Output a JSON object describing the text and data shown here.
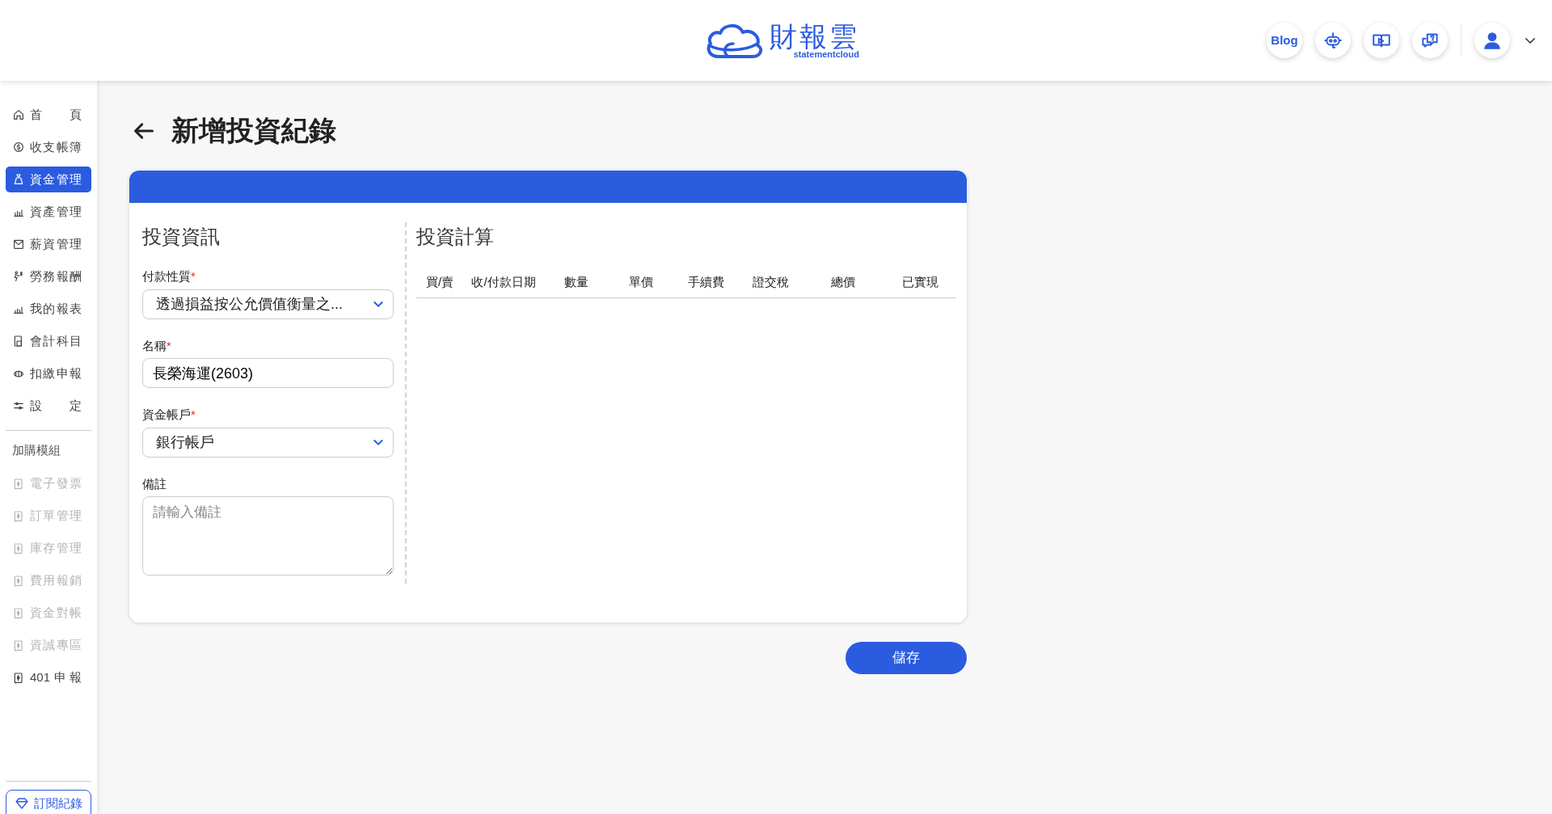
{
  "header": {
    "logo": {
      "name": "財報雲",
      "tagline": "statementcloud"
    },
    "blog_button": "Blog"
  },
  "sidebar": {
    "items": [
      {
        "label": "首頁",
        "selected": false
      },
      {
        "label": "收支帳簿",
        "selected": false
      },
      {
        "label": "資金管理",
        "selected": true
      },
      {
        "label": "資產管理",
        "selected": false
      },
      {
        "label": "薪資管理",
        "selected": false
      },
      {
        "label": "勞務報酬",
        "selected": false
      },
      {
        "label": "我的報表",
        "selected": false
      },
      {
        "label": "會計科目",
        "selected": false
      },
      {
        "label": "扣繳申報",
        "selected": false
      },
      {
        "label": "設定",
        "selected": false
      }
    ],
    "modules_title": "加購模組",
    "modules": [
      {
        "label": "電子發票",
        "disabled": true
      },
      {
        "label": "訂單管理",
        "disabled": true
      },
      {
        "label": "庫存管理",
        "disabled": true
      },
      {
        "label": "費用報銷",
        "disabled": true
      },
      {
        "label": "資金對帳",
        "disabled": true
      },
      {
        "label": "資誠專區",
        "disabled": true
      },
      {
        "label": "401申報",
        "disabled": false
      }
    ],
    "subscription_button": "訂閱紀錄"
  },
  "page_title": "新增投資紀錄",
  "info_section": {
    "title": "投資資訊",
    "fields": [
      {
        "kind": "select",
        "label": "付款性質",
        "required_mark": "*",
        "value": "透過損益按公允價值衡量之..."
      },
      {
        "kind": "input",
        "label": "名稱",
        "required_mark": "*",
        "value": "長榮海運(2603)"
      },
      {
        "kind": "select",
        "label": "資金帳戶",
        "required_mark": "*",
        "value": "銀行帳戶"
      },
      {
        "kind": "textarea",
        "label": "備註",
        "placeholder": "請輸入備註"
      }
    ]
  },
  "calc_section": {
    "title": "投資計算",
    "columns": [
      "買/賣",
      "收/付款日期",
      "數量",
      "單價",
      "手續費",
      "證交稅",
      "總價",
      "已實現"
    ]
  },
  "save_button": "儲存"
}
